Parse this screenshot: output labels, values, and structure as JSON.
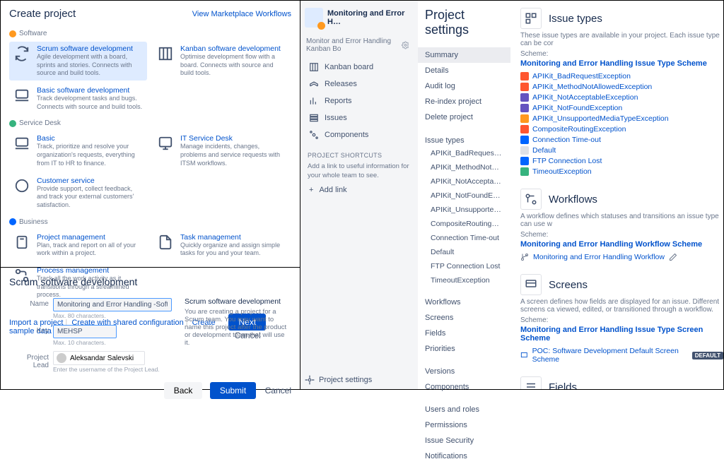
{
  "create": {
    "title": "Create project",
    "marketplace": "View Marketplace Workflows",
    "categories": [
      {
        "label": "Software",
        "dot": "d-o",
        "options": [
          {
            "k": "scrum",
            "title": "Scrum software development",
            "desc": "Agile development with a board, sprints and stories. Connects with source and build tools.",
            "selected": true,
            "icon": "loop"
          },
          {
            "k": "kanban",
            "title": "Kanban software development",
            "desc": "Optimise development flow with a board. Connects with source and build tools.",
            "icon": "board"
          },
          {
            "k": "basic",
            "title": "Basic software development",
            "desc": "Track development tasks and bugs. Connects with source and build tools.",
            "icon": "laptop"
          }
        ]
      },
      {
        "label": "Service Desk",
        "dot": "d-g",
        "options": [
          {
            "k": "sdbasic",
            "title": "Basic",
            "desc": "Track, prioritize and resolve your organization's requests, everything from IT to HR to finance.",
            "icon": "laptop"
          },
          {
            "k": "itsd",
            "title": "IT Service Desk",
            "desc": "Manage incidents, changes, problems and service requests with ITSM workflows.",
            "icon": "monitor"
          },
          {
            "k": "cs",
            "title": "Customer service",
            "desc": "Provide support, collect feedback, and track your external customers' satisfaction.",
            "icon": "chat"
          }
        ]
      },
      {
        "label": "Business",
        "dot": "d-b",
        "options": [
          {
            "k": "pm",
            "title": "Project management",
            "desc": "Plan, track and report on all of your work within a project.",
            "icon": "clipboard"
          },
          {
            "k": "tm",
            "title": "Task management",
            "desc": "Quickly organize and assign simple tasks for you and your team.",
            "icon": "page"
          },
          {
            "k": "proc",
            "title": "Process management",
            "desc": "Track all the work activity as it transitions through a streamlined process.",
            "icon": "flow"
          }
        ]
      }
    ],
    "footer_links": [
      "Import a project",
      "Create with shared configuration",
      "Create sample data"
    ],
    "next": "Next",
    "cancel": "Cancel"
  },
  "form": {
    "title": "Scrum software development",
    "name_label": "Name",
    "name_value": "Monitoring and Error Handling -Software Project",
    "name_hint": "Max. 80 characters.",
    "key_label": "Key",
    "key_value": "MEHSP",
    "key_hint": "Max. 10 characters.",
    "lead_label": "Project Lead",
    "lead_name": "Aleksandar Salevski",
    "lead_hint": "Enter the username of the Project Lead.",
    "right_title": "Scrum software development",
    "right_desc": "You are creating a project for a Scrum team. You may want to name this project after the product or development team that will use it.",
    "back": "Back",
    "submit": "Submit",
    "cancel": "Cancel"
  },
  "pnav": {
    "project": "Monitoring and Error H…",
    "subtitle": "Monitor and Error Handling Kanban Bo",
    "items": [
      {
        "label": "Kanban board",
        "icon": "board"
      },
      {
        "label": "Releases",
        "icon": "ship"
      },
      {
        "label": "Reports",
        "icon": "chart"
      },
      {
        "label": "Issues",
        "icon": "list"
      },
      {
        "label": "Components",
        "icon": "comp"
      }
    ],
    "shortcuts_h": "PROJECT SHORTCUTS",
    "shortcuts_d": "Add a link to useful information for your whole team to see.",
    "add_link": "Add link",
    "settings": "Project settings"
  },
  "settings": {
    "title": "Project settings",
    "top": [
      "Summary",
      "Details",
      "Audit log",
      "Re-index project",
      "Delete project"
    ],
    "issue_types_h": "Issue types",
    "issue_types": [
      "APIKit_BadRequestException",
      "APIKit_MethodNotAllowedE…",
      "APIKit_NotAcceptableExcept…",
      "APIKit_NotFoundException",
      "APIKit_UnsupportedMediaT…",
      "CompositeRoutingException",
      "Connection Time-out",
      "Default",
      "FTP Connection Lost",
      "TimeoutException"
    ],
    "mid": [
      "Workflows",
      "Screens",
      "Fields",
      "Priorities"
    ],
    "ver": [
      "Versions",
      "Components"
    ],
    "bot": [
      "Users and roles",
      "Permissions",
      "Issue Security",
      "Notifications"
    ]
  },
  "main": {
    "issue": {
      "title": "Issue types",
      "desc": "These issue types are available in your project. Each issue type can be cor",
      "scheme_l": "Scheme:",
      "scheme": "Monitoring and Error Handling Issue Type Scheme",
      "types": [
        {
          "color": "#ff5630",
          "name": "APIKit_BadRequestException"
        },
        {
          "color": "#ff5630",
          "name": "APIKit_MethodNotAllowedException"
        },
        {
          "color": "#6554c0",
          "name": "APIKit_NotAcceptableException"
        },
        {
          "color": "#6554c0",
          "name": "APIKit_NotFoundException"
        },
        {
          "color": "#ff991f",
          "name": "APIKit_UnsupportedMediaTypeException"
        },
        {
          "color": "#ff5630",
          "name": "CompositeRoutingException"
        },
        {
          "color": "#0065ff",
          "name": "Connection Time-out"
        },
        {
          "color": "#dfe1e6",
          "name": "Default"
        },
        {
          "color": "#0065ff",
          "name": "FTP Connection Lost"
        },
        {
          "color": "#36b37e",
          "name": "TimeoutException"
        }
      ]
    },
    "workflows": {
      "title": "Workflows",
      "desc": "A workflow defines which statuses and transitions an issue type can use w",
      "scheme_l": "Scheme:",
      "scheme": "Monitoring and Error Handling Workflow Scheme",
      "item": "Monitoring and Error Handling Workflow"
    },
    "screens": {
      "title": "Screens",
      "desc": "A screen defines how fields are displayed for an issue. Different screens ca viewed, edited, or transitioned through a workflow.",
      "scheme_l": "Scheme:",
      "scheme": "Monitoring and Error Handling Issue Type Screen Scheme",
      "item": "POC: Software Development Default Screen Scheme",
      "badge": "DEFAULT"
    },
    "fields": {
      "title": "Fields"
    }
  }
}
